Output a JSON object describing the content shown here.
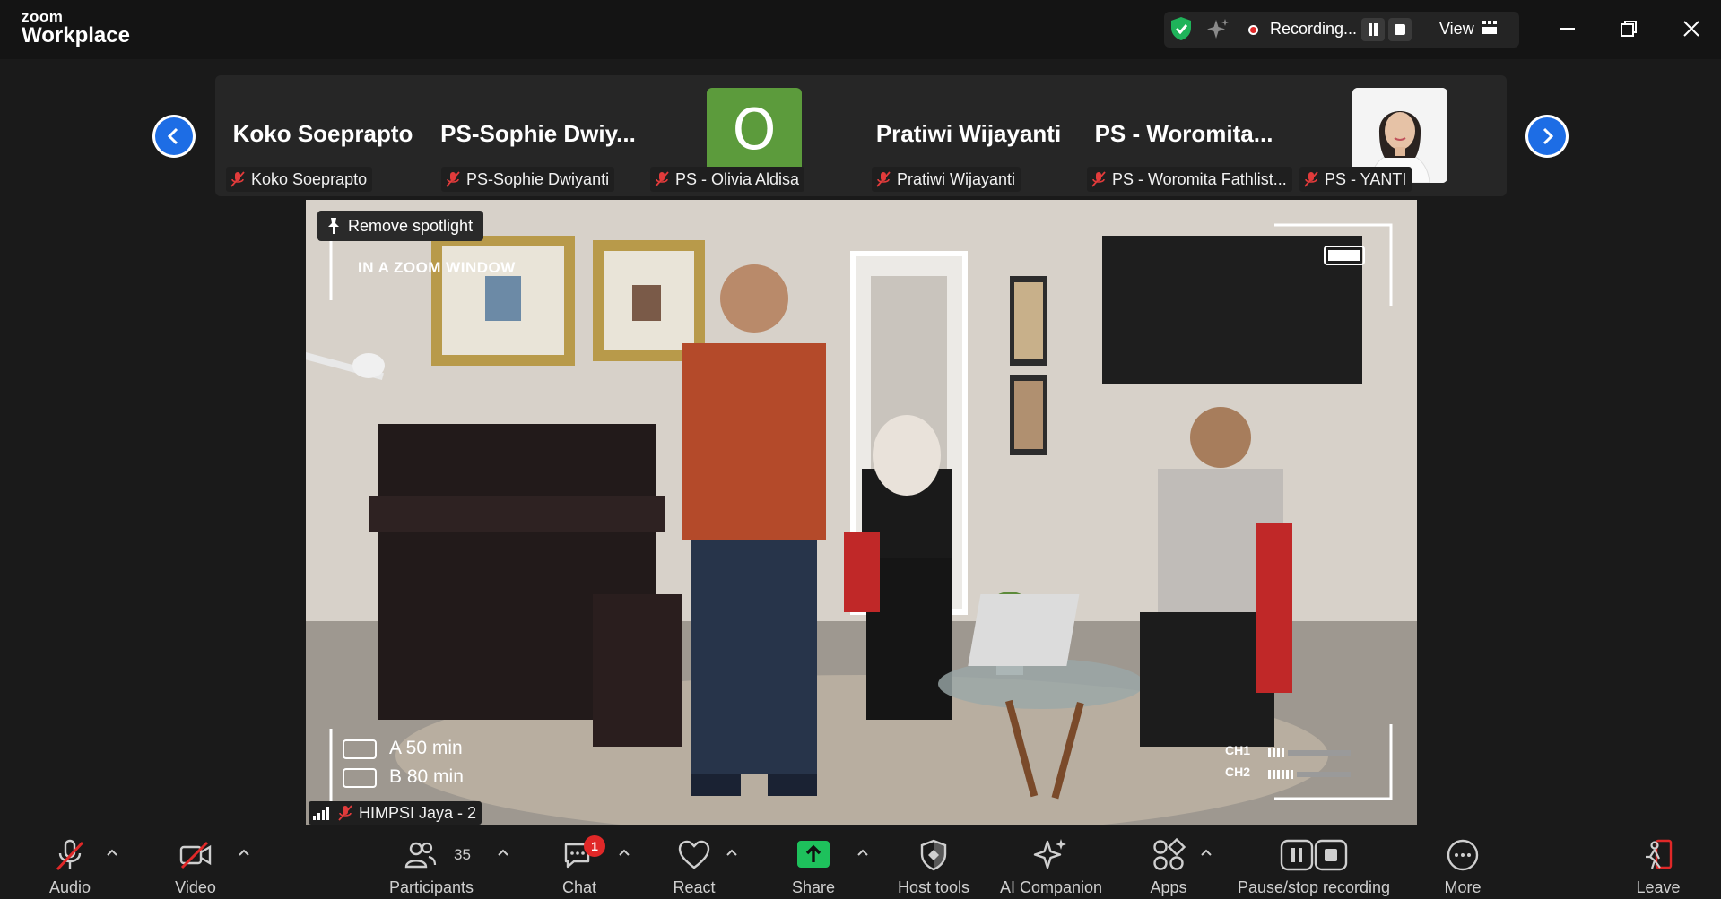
{
  "titlebar": {
    "brand_small": "zoom",
    "brand_large": "Workplace",
    "recording_label": "Recording...",
    "view_label": "View"
  },
  "strip": {
    "participants": [
      {
        "tile_name": "Koko Soeprapto",
        "label": "Koko Soeprapto"
      },
      {
        "tile_name": "PS-Sophie  Dwiy...",
        "label": "PS-Sophie Dwiyanti"
      },
      {
        "tile_name": "O",
        "label": "PS - Olivia Aldisa"
      },
      {
        "tile_name": "Pratiwi Wijayanti",
        "label": "Pratiwi Wijayanti"
      },
      {
        "tile_name": "PS  -  Woromita...",
        "label": "PS - Woromita Fathlist..."
      },
      {
        "tile_name": "",
        "label": "PS - YANTI"
      }
    ],
    "avatar_color": "#5c9b3c"
  },
  "spotlight": {
    "remove_label": "Remove spotlight",
    "overlay_title": "IN A ZOOM WINDOW",
    "battery_a": "A  50 min",
    "battery_b": "B  80 min",
    "ch1": "CH1",
    "ch2": "CH2",
    "speaker_label": "HIMPSI Jaya - 2"
  },
  "toolbar": {
    "audio": "Audio",
    "video": "Video",
    "participants": "Participants",
    "participants_count": "35",
    "chat": "Chat",
    "chat_badge": "1",
    "react": "React",
    "share": "Share",
    "host_tools": "Host tools",
    "ai_companion": "AI Companion",
    "apps": "Apps",
    "pause_stop": "Pause/stop recording",
    "more": "More",
    "leave": "Leave"
  },
  "colors": {
    "accent_blue": "#1d6de5",
    "share_green": "#1ec15c",
    "leave_red": "#e02828",
    "shield_green": "#1fb35a"
  }
}
